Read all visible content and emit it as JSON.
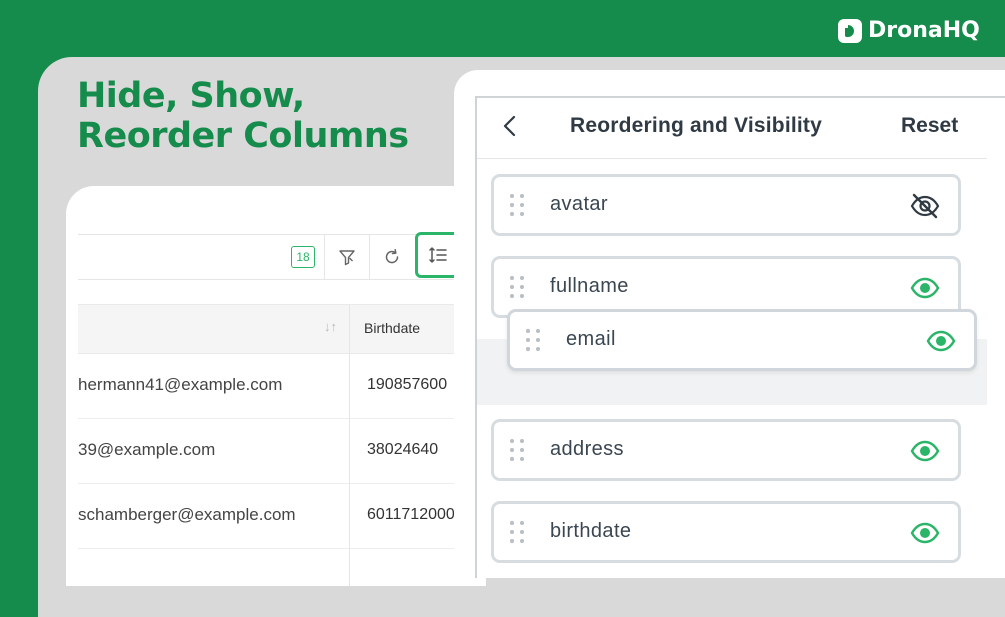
{
  "brand": {
    "name": "DronaHQ"
  },
  "headline": {
    "line1": "Hide, Show,",
    "line2": "Reorder Columns"
  },
  "table": {
    "toolbar": {
      "count_badge": "18"
    },
    "header": {
      "birthdate": "Birthdate"
    },
    "rows": [
      {
        "email": "hermann41@example.com",
        "birthdate": "190857600"
      },
      {
        "email": "39@example.com",
        "birthdate": "38024640"
      },
      {
        "email": "schamberger@example.com",
        "birthdate": "6011712000"
      }
    ]
  },
  "panel": {
    "title": "Reordering and Visibility",
    "reset": "Reset",
    "columns": [
      {
        "label": "avatar",
        "visible": false
      },
      {
        "label": "fullname",
        "visible": true
      },
      {
        "label": "email",
        "visible": true,
        "state": "dragging"
      },
      {
        "label": "address",
        "visible": true
      },
      {
        "label": "birthdate",
        "visible": true
      }
    ]
  },
  "colors": {
    "brand": "#168c4c",
    "accent": "#2bb568",
    "text": "#2f3a44"
  }
}
